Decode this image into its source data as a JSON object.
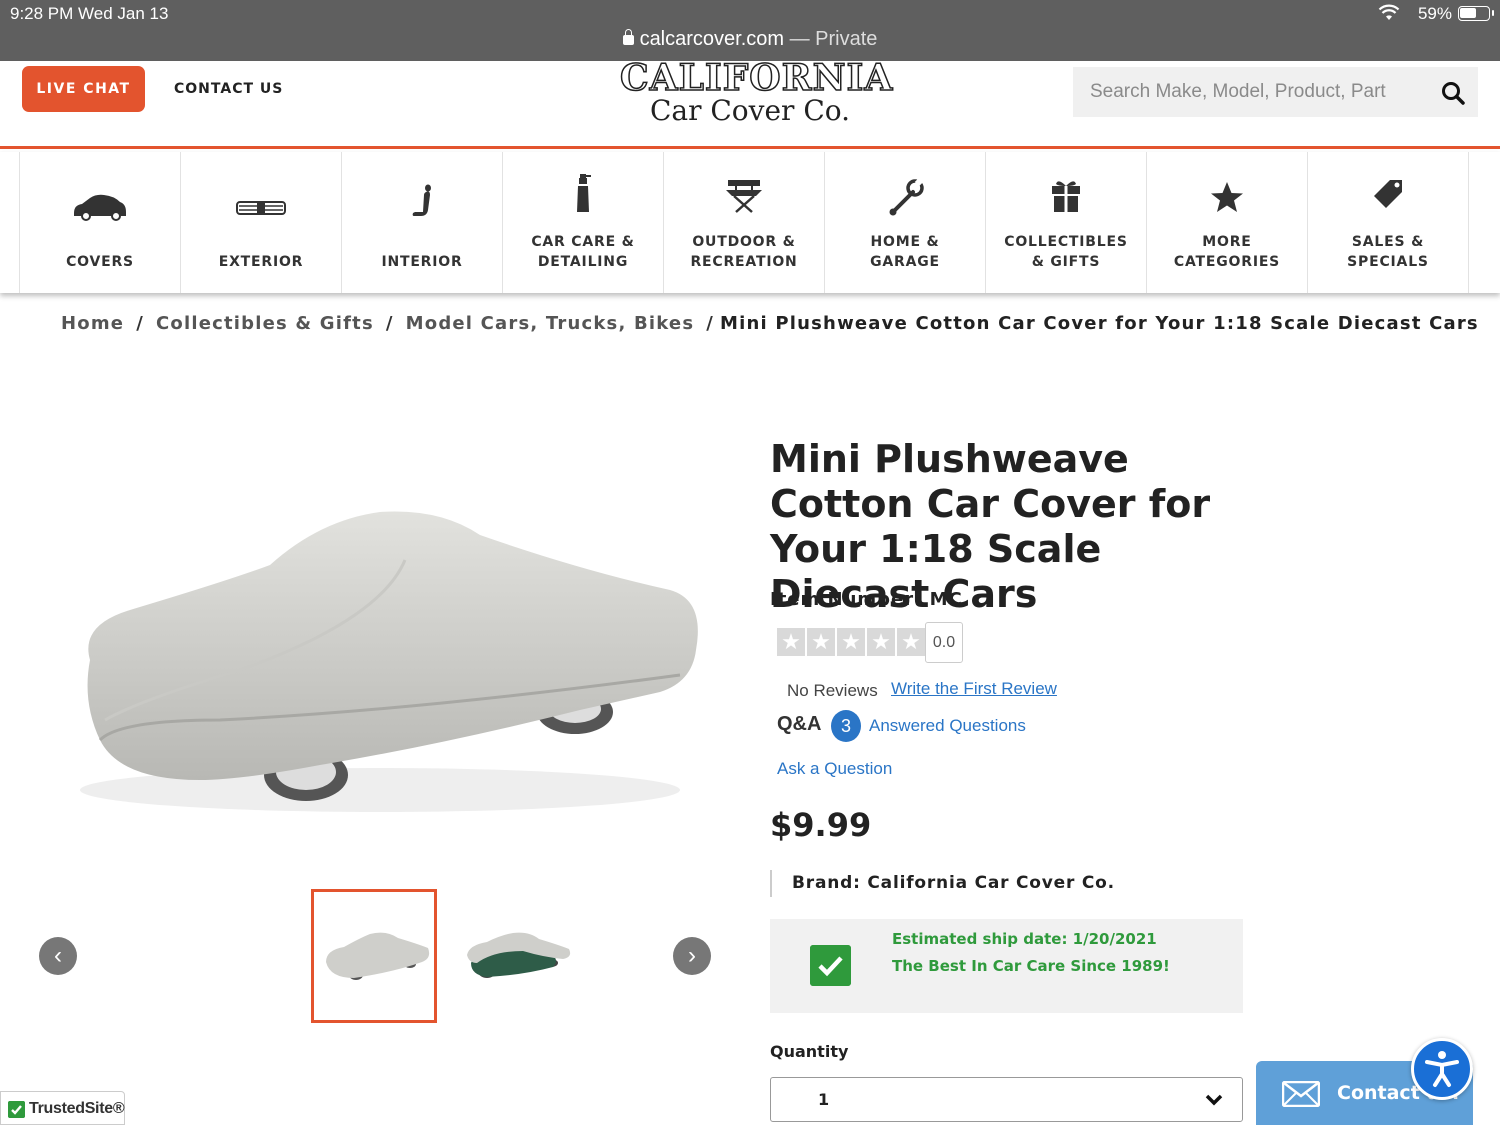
{
  "status_bar": {
    "time": "9:28 PM   Wed Jan 13",
    "battery": "59%",
    "battery_level": 0.59
  },
  "url_bar": {
    "domain": "calcarcover.com",
    "mode": " — Private"
  },
  "header": {
    "live_chat": "LIVE CHAT",
    "contact_us": "CONTACT US",
    "logo_line1": "CALIFORNIA",
    "logo_line2": "Car Cover Co.",
    "search_placeholder": "Search Make, Model, Product, Part"
  },
  "categories": [
    {
      "label": "COVERS",
      "icon": "car-icon"
    },
    {
      "label": "EXTERIOR",
      "icon": "grille-icon"
    },
    {
      "label": "INTERIOR",
      "icon": "seat-icon"
    },
    {
      "label": "CAR CARE &\nDETAILING",
      "icon": "spray-bottle-icon"
    },
    {
      "label": "OUTDOOR &\nRECREATION",
      "icon": "camp-chair-icon"
    },
    {
      "label": "HOME &\nGARAGE",
      "icon": "wrench-icon"
    },
    {
      "label": "COLLECTIBLES\n& GIFTS",
      "icon": "gift-icon"
    },
    {
      "label": "MORE\nCATEGORIES",
      "icon": "star-icon"
    },
    {
      "label": "SALES &\nSPECIALS",
      "icon": "tag-icon"
    }
  ],
  "breadcrumb": [
    "Home",
    "Collectibles & Gifts",
    "Model Cars, Trucks, Bikes",
    "Mini Plushweave Cotton Car Cover for Your 1:18 Scale Diecast Cars"
  ],
  "product": {
    "title": "Mini Plushweave Cotton Car Cover for Your 1:18 Scale Diecast Cars",
    "item_number": "Item Number: MC",
    "rating": "0.0",
    "no_reviews": "No Reviews",
    "write_review": "Write the First Review",
    "qa_label": "Q&A",
    "qa_count": "3",
    "answered_questions": "Answered Questions",
    "ask_question": "Ask a Question",
    "price": "$9.99",
    "brand": "Brand: California Car Cover Co.",
    "ship_date": "Estimated ship date: 1/20/2021",
    "tagline": "The Best In Car Care Since 1989!",
    "quantity_label": "Quantity",
    "quantity_value": "1"
  },
  "widgets": {
    "contact": "Contact us!",
    "trusted_site": "TrustedSite®"
  },
  "colors": {
    "brand_orange": "#e3542e",
    "link_blue": "#2a75c6",
    "success_green": "#2f9a3c"
  }
}
